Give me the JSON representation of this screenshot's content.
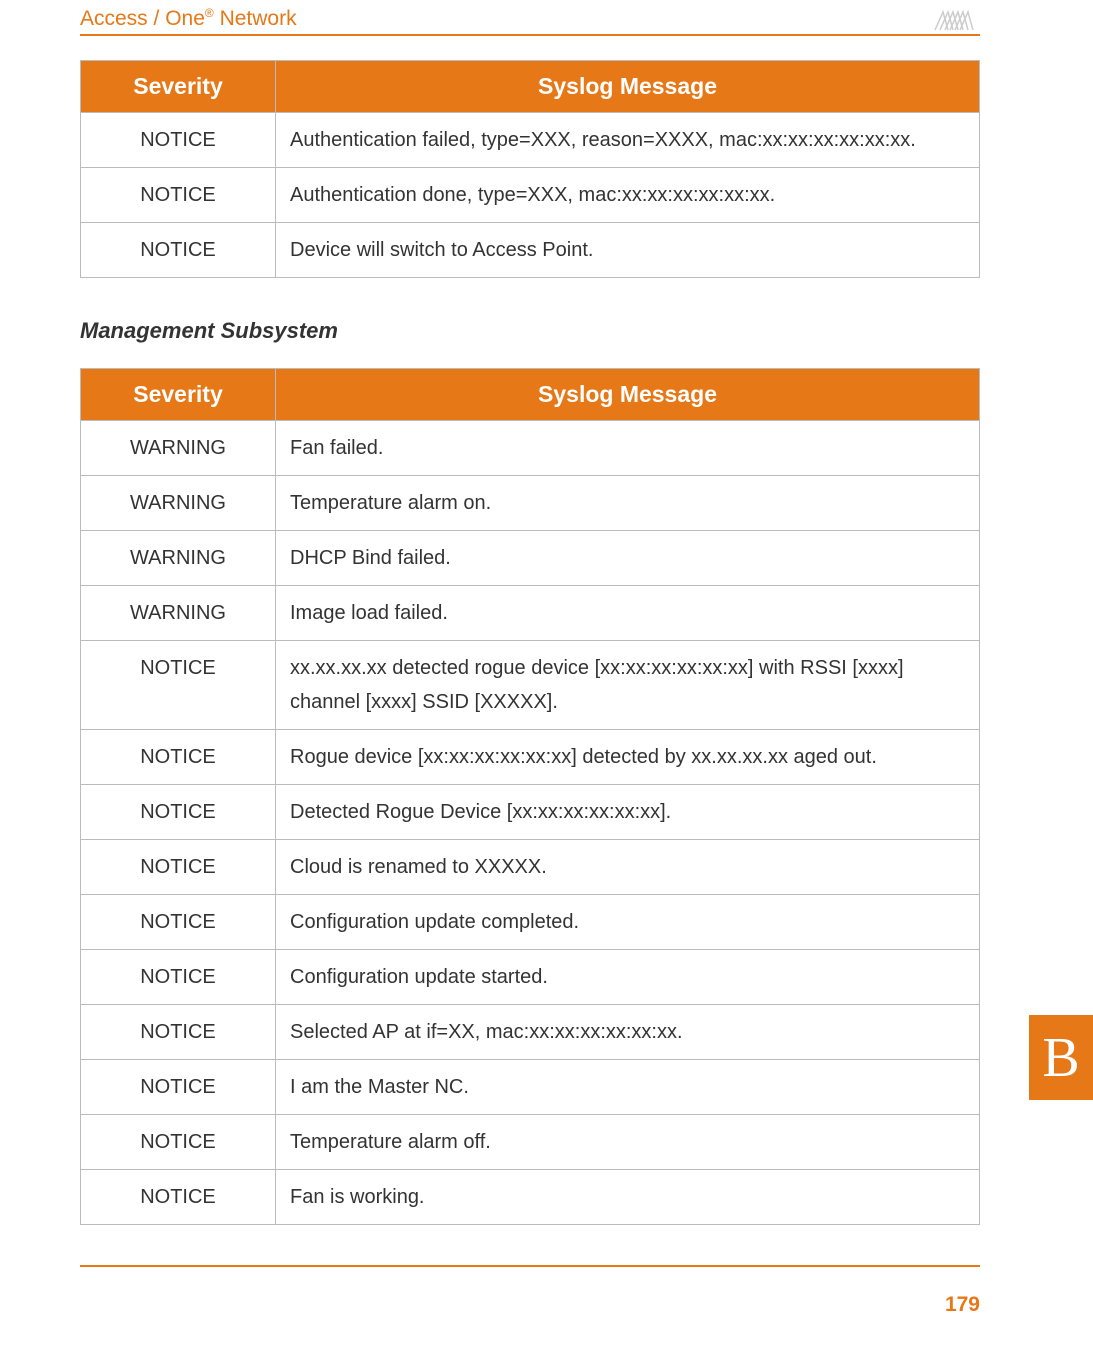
{
  "header": {
    "title_prefix": "Access / One",
    "title_reg": "®",
    "title_suffix": " Network"
  },
  "table1": {
    "headers": {
      "severity": "Severity",
      "message": "Syslog Message"
    },
    "rows": [
      {
        "severity": "NOTICE",
        "message": "Authentication failed, type=XXX, reason=XXXX, mac:xx:xx:xx:xx:xx:xx."
      },
      {
        "severity": "NOTICE",
        "message": "Authentication done, type=XXX, mac:xx:xx:xx:xx:xx:xx."
      },
      {
        "severity": "NOTICE",
        "message": "Device will switch to Access Point."
      }
    ]
  },
  "section_heading": "Management Subsystem",
  "table2": {
    "headers": {
      "severity": "Severity",
      "message": "Syslog Message"
    },
    "rows": [
      {
        "severity": "WARNING",
        "message": "Fan failed."
      },
      {
        "severity": "WARNING",
        "message": "Temperature alarm on."
      },
      {
        "severity": "WARNING",
        "message": "DHCP Bind failed."
      },
      {
        "severity": "WARNING",
        "message": "Image load failed."
      },
      {
        "severity": "NOTICE",
        "message": "xx.xx.xx.xx detected rogue device [xx:xx:xx:xx:xx:xx] with RSSI [xxxx] channel [xxxx] SSID [XXXXX]."
      },
      {
        "severity": "NOTICE",
        "message": "Rogue device [xx:xx:xx:xx:xx:xx] detected by xx.xx.xx.xx aged out."
      },
      {
        "severity": "NOTICE",
        "message": "Detected Rogue Device [xx:xx:xx:xx:xx:xx]."
      },
      {
        "severity": "NOTICE",
        "message": "Cloud is renamed to XXXXX."
      },
      {
        "severity": "NOTICE",
        "message": "Configuration update completed."
      },
      {
        "severity": "NOTICE",
        "message": "Configuration update started."
      },
      {
        "severity": "NOTICE",
        "message": "Selected AP at if=XX, mac:xx:xx:xx:xx:xx:xx."
      },
      {
        "severity": "NOTICE",
        "message": "I am the Master NC."
      },
      {
        "severity": "NOTICE",
        "message": "Temperature alarm off."
      },
      {
        "severity": "NOTICE",
        "message": "Fan is working."
      }
    ]
  },
  "side_tab": "B",
  "page_number": "179"
}
